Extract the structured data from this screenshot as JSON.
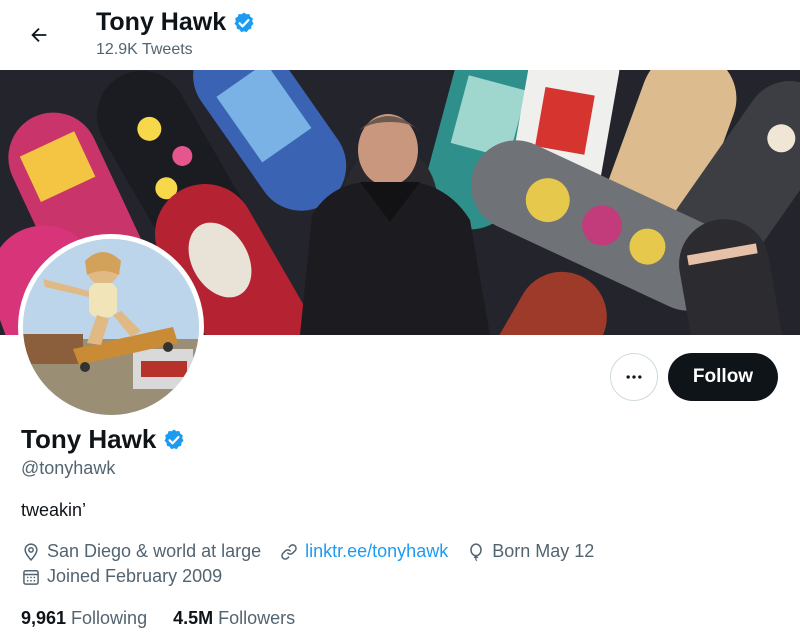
{
  "header": {
    "title": "Tony Hawk",
    "tweet_count": "12.9K Tweets"
  },
  "profile": {
    "name": "Tony Hawk",
    "handle": "@tonyhawk",
    "bio": "tweakin’",
    "location": "San Diego & world at large",
    "website": "linktr.ee/tonyhawk",
    "birthday": "Born May 12",
    "joined": "Joined February 2009",
    "following_count": "9,961",
    "following_label": "Following",
    "followers_count": "4.5M",
    "followers_label": "Followers"
  },
  "actions": {
    "follow_label": "Follow"
  },
  "icons": {
    "back": "arrow-left-icon",
    "verified": "verified-badge-icon",
    "more": "more-horizontal-icon",
    "location": "location-pin-icon",
    "link": "link-icon",
    "birthday": "balloon-icon",
    "calendar": "calendar-icon"
  },
  "colors": {
    "accent": "#1d9bf0",
    "text_primary": "#0f1419",
    "text_secondary": "#536471",
    "follow_button_bg": "#0f1419",
    "border": "#cfd9de"
  }
}
